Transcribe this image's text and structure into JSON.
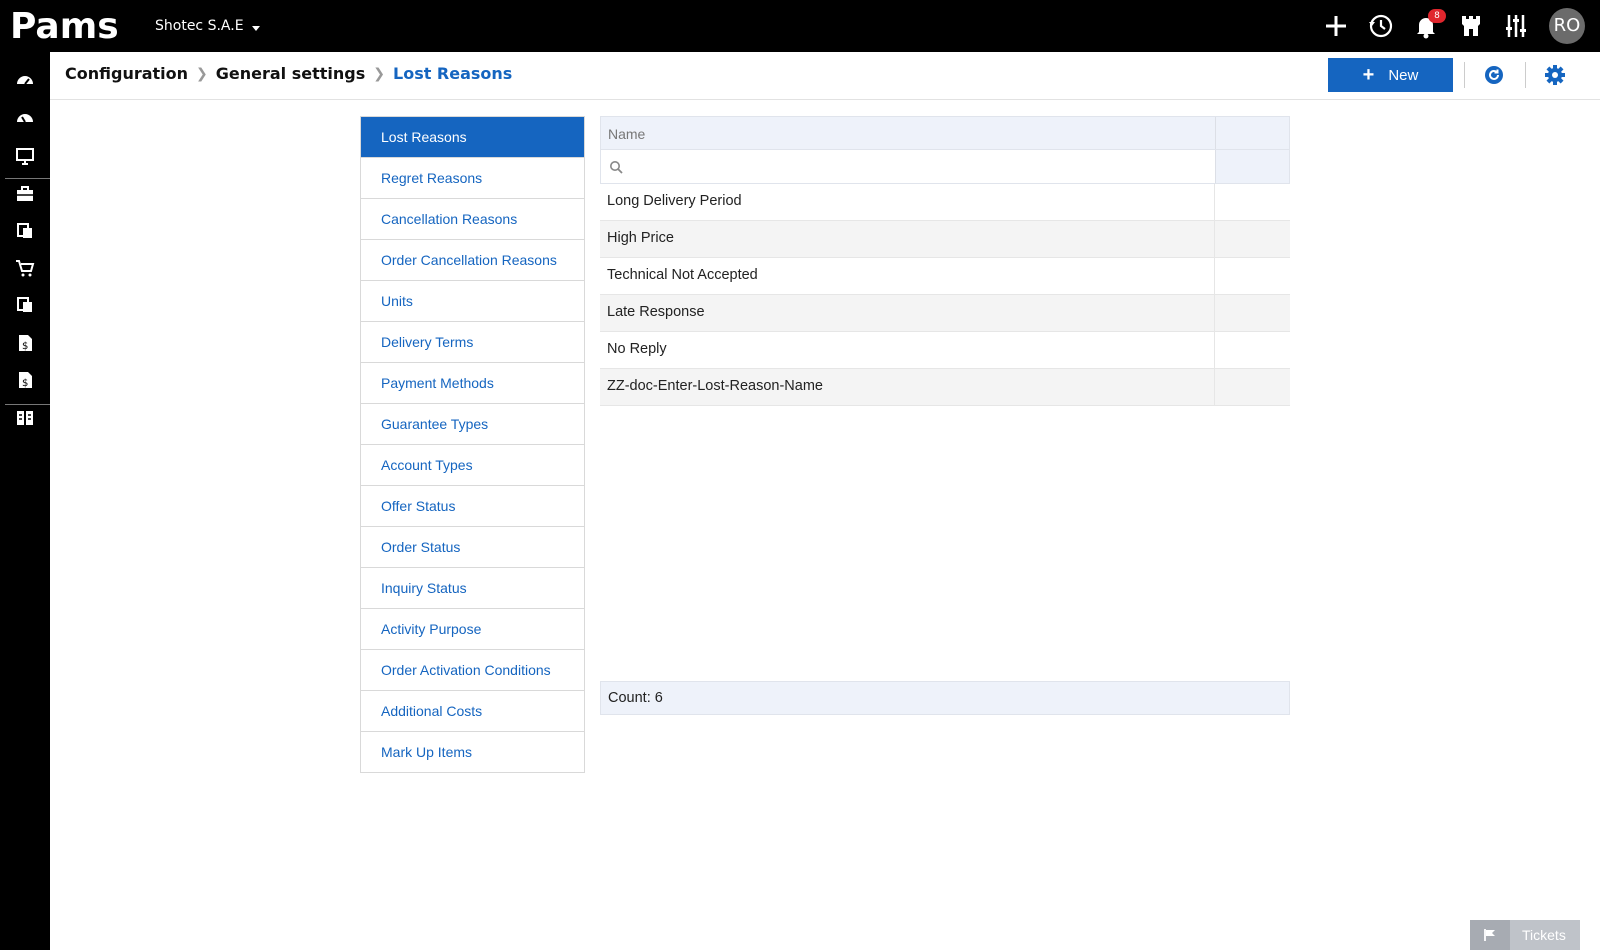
{
  "app": {
    "logo_text": "Pams",
    "company": "Shotec S.A.E"
  },
  "topbar": {
    "notification_count": "8",
    "avatar_initials": "RO"
  },
  "breadcrumb": {
    "items": [
      "Configuration",
      "General settings"
    ],
    "current": "Lost Reasons"
  },
  "header": {
    "new_label": "New"
  },
  "menu": {
    "items": [
      "Lost Reasons",
      "Regret Reasons",
      "Cancellation Reasons",
      "Order Cancellation Reasons",
      "Units",
      "Delivery Terms",
      "Payment Methods",
      "Guarantee Types",
      "Account Types",
      "Offer Status",
      "Order Status",
      "Inquiry Status",
      "Activity Purpose",
      "Order Activation Conditions",
      "Additional Costs",
      "Mark Up Items"
    ],
    "active_index": 0
  },
  "grid": {
    "column_name": "Name",
    "search_value": "",
    "rows": [
      "Long Delivery Period",
      "High Price",
      "Technical Not Accepted",
      "Late Response",
      "No Reply",
      "ZZ-doc-Enter-Lost-Reason-Name"
    ],
    "footer": "Count: 6"
  },
  "tickets": {
    "label": "Tickets"
  },
  "colors": {
    "accent": "#1565c0",
    "badge": "#e0262d",
    "topbar": "#000000",
    "header_bg": "#eef2fa"
  },
  "icons": {
    "top": [
      "plus-icon",
      "history-icon",
      "bell-icon",
      "castle-icon",
      "sliders-icon"
    ],
    "rail": [
      "dashboard-icon",
      "dashboard-alt-icon",
      "monitor-icon",
      "briefcase-icon",
      "documents-icon",
      "cart-icon",
      "documents-alt-icon",
      "invoice-icon",
      "invoice-alt-icon",
      "reports-icon"
    ],
    "header": [
      "refresh-icon",
      "settings-gear-icon"
    ]
  }
}
